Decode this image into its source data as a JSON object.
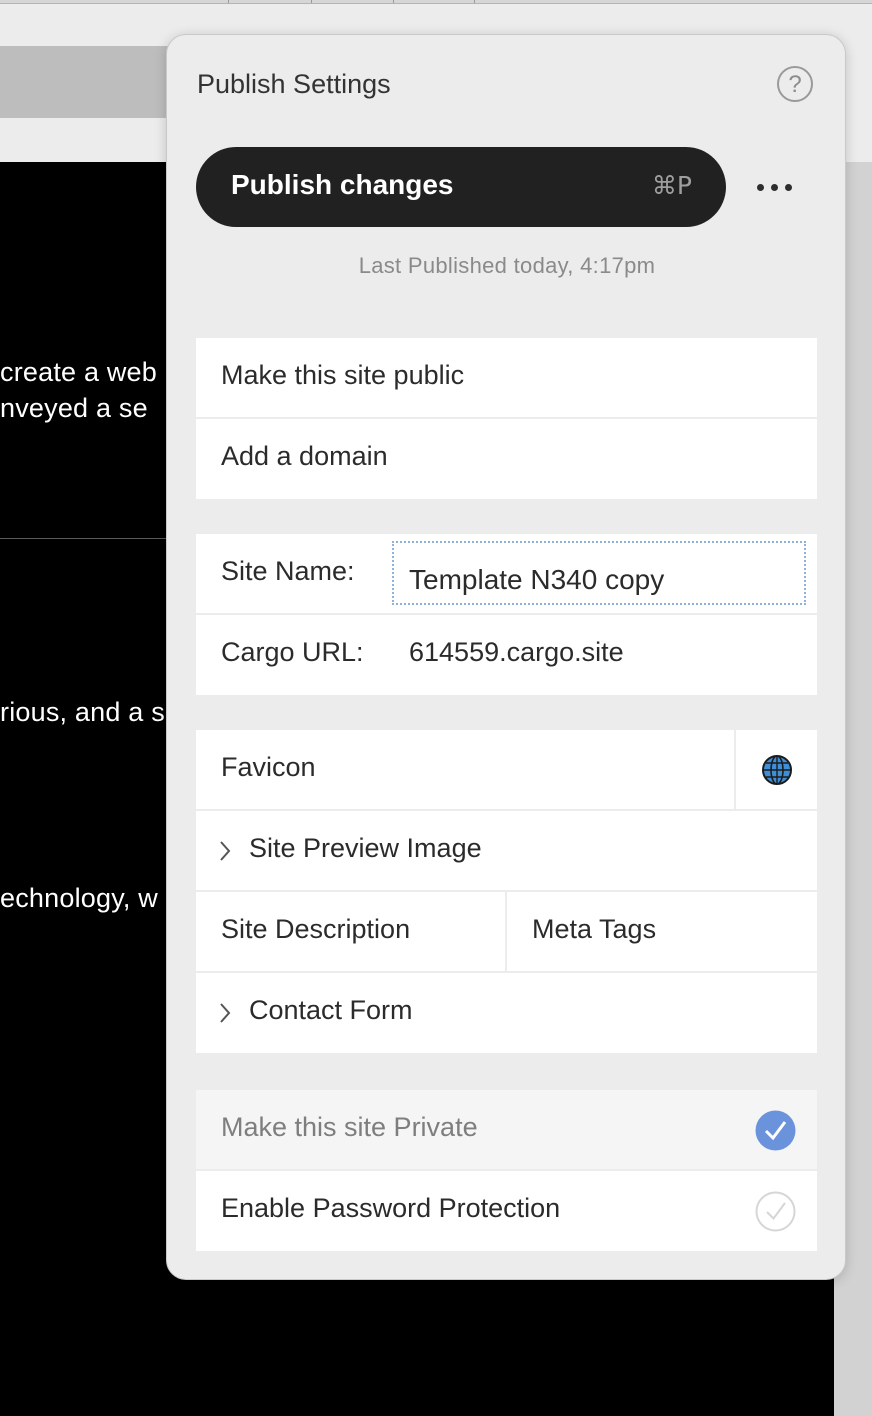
{
  "background": {
    "text_lines": [
      "create a web",
      "nveyed a se",
      "rious, and a s",
      "echnology, w"
    ]
  },
  "panel": {
    "title": "Publish Settings",
    "help_label": "?",
    "publish_button": {
      "label": "Publish changes",
      "shortcut": "⌘P"
    },
    "last_published": "Last Published today, 4:17pm",
    "visibility": {
      "make_public": "Make this site public",
      "add_domain": "Add a domain"
    },
    "site_info": {
      "site_name_label": "Site Name:",
      "site_name_value": "Template N340 copy",
      "cargo_url_label": "Cargo URL:",
      "cargo_url_value": "614559.cargo.site"
    },
    "meta": {
      "favicon": "Favicon",
      "site_preview_image": "Site Preview Image",
      "site_description": "Site Description",
      "meta_tags": "Meta Tags",
      "contact_form": "Contact Form"
    },
    "privacy": {
      "make_private": {
        "label": "Make this site Private",
        "checked": true
      },
      "password_protection": {
        "label": "Enable Password Protection",
        "checked": false
      }
    },
    "colors": {
      "accent": "#6b93dc",
      "button_bg": "#212121"
    }
  }
}
